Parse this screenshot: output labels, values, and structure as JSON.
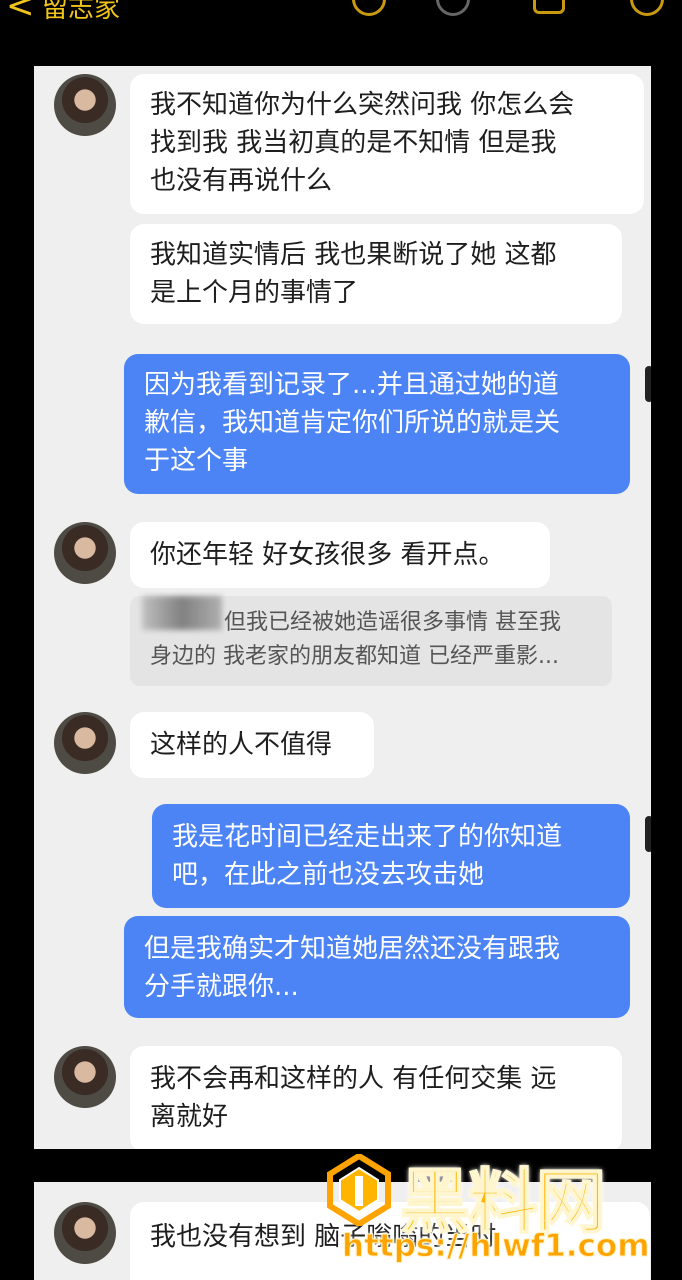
{
  "header": {
    "back_glyph": "<",
    "title": "留志家"
  },
  "messages": [
    {
      "side": "left",
      "lines": [
        "我不知道你为什么突然问我 你怎么会",
        "找到我 我当初真的是不知情 但是我",
        "也没有再说什么"
      ]
    },
    {
      "side": "left",
      "lines": [
        "我知道实情后 我也果断说了她 这都",
        "是上个月的事情了"
      ]
    },
    {
      "side": "right",
      "lines": [
        "因为我看到记录了...并且通过她的道",
        "歉信，我知道肯定你们所说的就是关",
        "于这个事"
      ]
    },
    {
      "side": "left",
      "lines": [
        "你还年轻 好女孩很多 看开点。"
      ]
    },
    {
      "side": "quote",
      "lines": [
        "但我已经被她造谣很多事情 甚至我",
        "身边的 我老家的朋友都知道 已经严重影..."
      ]
    },
    {
      "side": "left",
      "lines": [
        "这样的人不值得"
      ]
    },
    {
      "side": "right",
      "lines": [
        "我是花时间已经走出来了的你知道",
        "吧，在此之前也没去攻击她"
      ]
    },
    {
      "side": "right",
      "lines": [
        "但是我确实才知道她居然还没有跟我",
        "分手就跟你..."
      ]
    },
    {
      "side": "left",
      "lines": [
        "我不会再和这样的人 有任何交集 远",
        "离就好"
      ]
    },
    {
      "side": "left",
      "lines": [
        "我也没有想到 脑子嗡嗡的当时"
      ]
    }
  ],
  "watermark": {
    "brand": "黑料网",
    "url": "https://hlwf1.com"
  },
  "colors": {
    "accent": "#f0c419",
    "bubble_blue": "#4c84f5",
    "chat_bg": "#efefef",
    "watermark": "#ffb500"
  }
}
